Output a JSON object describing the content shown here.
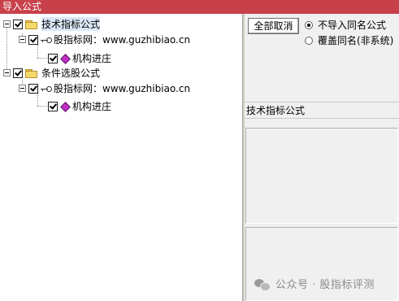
{
  "window": {
    "title": "导入公式"
  },
  "tree": {
    "groups": [
      {
        "label": "技术指标公式",
        "checked": true,
        "children": [
          {
            "label": "股指标网：www.guzhibiao.cn",
            "checked": true,
            "children": [
              {
                "label": "机构进庄",
                "checked": true
              }
            ]
          }
        ]
      },
      {
        "label": "条件选股公式",
        "checked": true,
        "children": [
          {
            "label": "股指标网：www.guzhibiao.cn",
            "checked": true,
            "children": [
              {
                "label": "机构进庄",
                "checked": true
              }
            ]
          }
        ]
      }
    ]
  },
  "options": {
    "deselect_all_label": "全部取消",
    "radio_skip_label": "不导入同名公式",
    "radio_overwrite_label": "覆盖同名(非系统)",
    "selected": "不导入同名公式"
  },
  "detail": {
    "section_label": "技术指标公式"
  },
  "watermark": {
    "text": "公众号 · 股指标评测"
  },
  "colors": {
    "titlebar": "#c8414a",
    "selection": "#dce8f7",
    "panel": "#f0f0f0"
  }
}
